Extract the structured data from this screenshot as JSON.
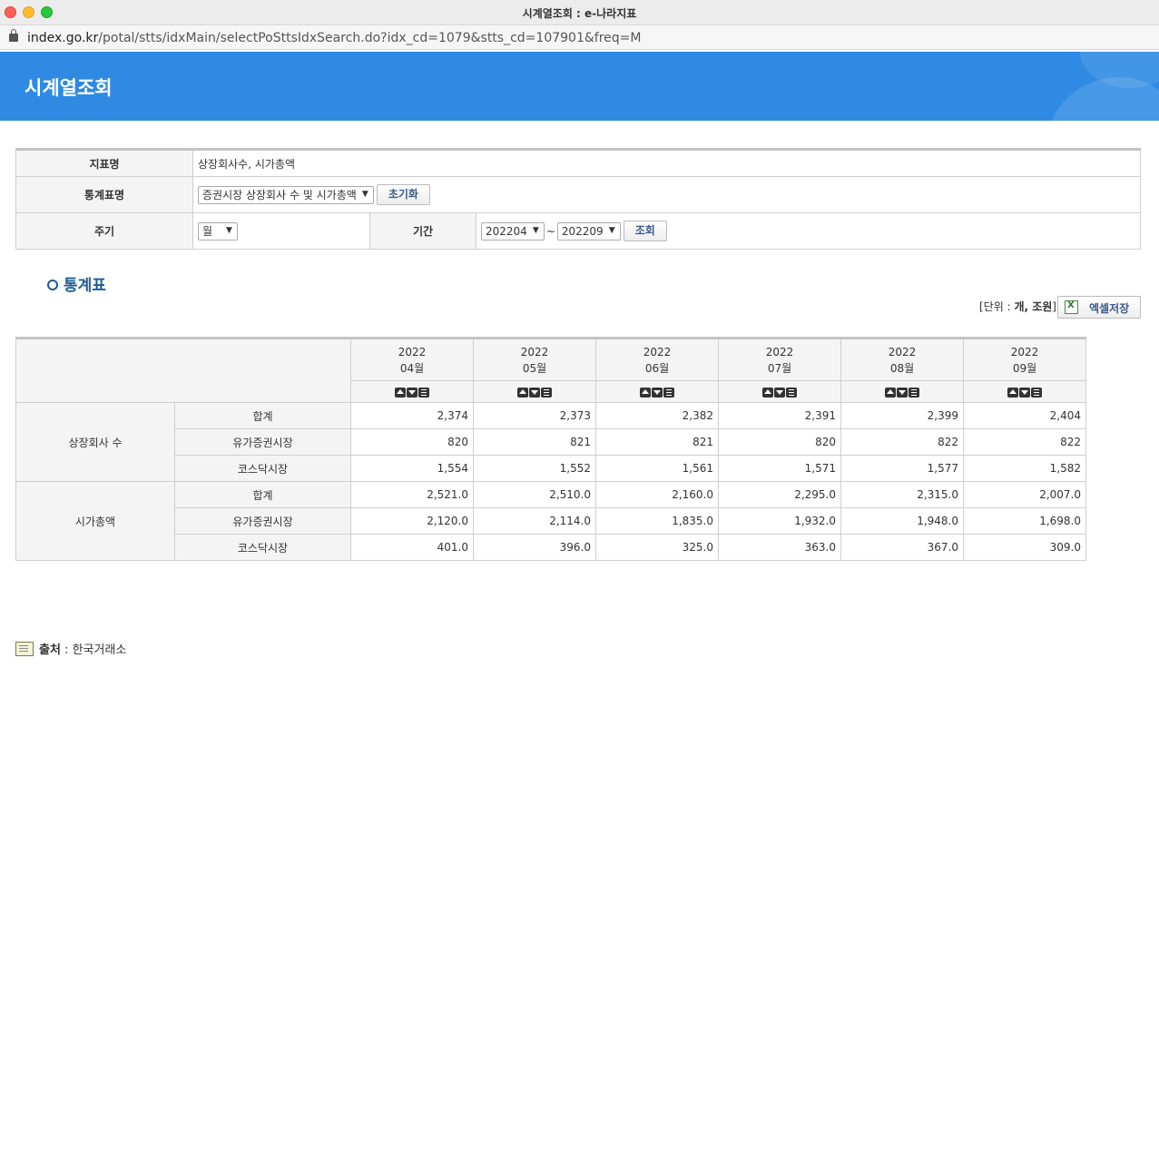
{
  "window": {
    "title": "시계열조회 : e-나라지표",
    "url_host": "index.go.kr",
    "url_path": "/potal/stts/idxMain/selectPoSttsIdxSearch.do?idx_cd=1079&stts_cd=107901&freq=M"
  },
  "header": {
    "title": "시계열조회"
  },
  "form": {
    "indicator_label": "지표명",
    "indicator_value": "상장회사수, 시가총액",
    "table_label": "통계표명",
    "table_value": "증권시장 상장회사 수 및 시가총액",
    "reset_label": "초기화",
    "cycle_label": "주기",
    "cycle_value": "월",
    "period_label": "기간",
    "period_from": "202204",
    "period_sep": "~",
    "period_to": "202209",
    "search_label": "조회"
  },
  "section": {
    "title": "통계표"
  },
  "unit": {
    "prefix": "[단위 : ",
    "value": "개, 조원",
    "suffix": "]"
  },
  "excel": {
    "label": "엑셀저장"
  },
  "table": {
    "columns": [
      {
        "year": "2022",
        "month": "04월"
      },
      {
        "year": "2022",
        "month": "05월"
      },
      {
        "year": "2022",
        "month": "06월"
      },
      {
        "year": "2022",
        "month": "07월"
      },
      {
        "year": "2022",
        "month": "08월"
      },
      {
        "year": "2022",
        "month": "09월"
      }
    ],
    "groups": [
      {
        "name": "상장회사 수",
        "rows": [
          {
            "label": "합계",
            "values": [
              "2,374",
              "2,373",
              "2,382",
              "2,391",
              "2,399",
              "2,404"
            ]
          },
          {
            "label": "유가증권시장",
            "values": [
              "820",
              "821",
              "821",
              "820",
              "822",
              "822"
            ]
          },
          {
            "label": "코스닥시장",
            "values": [
              "1,554",
              "1,552",
              "1,561",
              "1,571",
              "1,577",
              "1,582"
            ]
          }
        ]
      },
      {
        "name": "시가총액",
        "rows": [
          {
            "label": "합계",
            "values": [
              "2,521.0",
              "2,510.0",
              "2,160.0",
              "2,295.0",
              "2,315.0",
              "2,007.0"
            ]
          },
          {
            "label": "유가증권시장",
            "values": [
              "2,120.0",
              "2,114.0",
              "1,835.0",
              "1,932.0",
              "1,948.0",
              "1,698.0"
            ]
          },
          {
            "label": "코스닥시장",
            "values": [
              "401.0",
              "396.0",
              "325.0",
              "363.0",
              "367.0",
              "309.0"
            ]
          }
        ]
      }
    ]
  },
  "source": {
    "label": "출처",
    "sep": " : ",
    "value": "한국거래소"
  }
}
